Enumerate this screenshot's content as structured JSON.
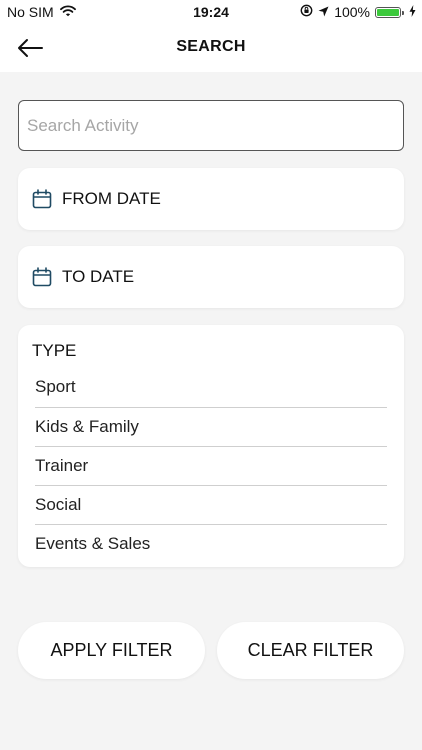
{
  "status_bar": {
    "carrier": "No SIM",
    "time": "19:24",
    "battery": "100%"
  },
  "nav": {
    "title": "SEARCH"
  },
  "search": {
    "placeholder": "Search Activity",
    "value": ""
  },
  "from_date": {
    "label": "FROM DATE"
  },
  "to_date": {
    "label": "TO DATE"
  },
  "type": {
    "title": "TYPE",
    "items": [
      "Sport",
      "Kids & Family",
      "Trainer",
      "Social",
      "Events & Sales"
    ]
  },
  "buttons": {
    "apply": "APPLY FILTER",
    "clear": "CLEAR FILTER"
  },
  "colors": {
    "background": "#f4f4f4",
    "card": "#ffffff",
    "calendar_icon": "#1f4a63",
    "battery": "#3cc93c"
  }
}
